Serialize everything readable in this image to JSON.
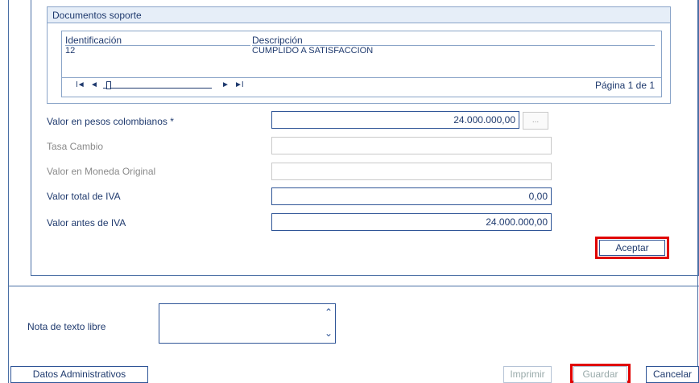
{
  "docs": {
    "title": "Documentos soporte",
    "columns": [
      "Identificación",
      "Descripción"
    ],
    "rows": [
      {
        "identificacion": "12",
        "descripcion": "CUMPLIDO A SATISFACCION"
      }
    ],
    "pager": {
      "first": "I◄",
      "prev": "◄",
      "next": "►",
      "last": "►I",
      "page_info": "Página 1 de 1"
    }
  },
  "form": {
    "valor_pesos": {
      "label": "Valor en pesos colombianos *",
      "value": "24.000.000,00"
    },
    "ellipsis": "...",
    "tasa_cambio": {
      "label": "Tasa Cambio",
      "value": ""
    },
    "valor_moneda": {
      "label": "Valor en Moneda Original",
      "value": ""
    },
    "valor_iva": {
      "label": "Valor total de IVA",
      "value": "0,00"
    },
    "valor_antes_iva": {
      "label": "Valor antes de IVA",
      "value": "24.000.000,00"
    },
    "aceptar": "Aceptar"
  },
  "nota": {
    "label": "Nota de texto libre",
    "value": ""
  },
  "footer": {
    "datos": "Datos Administrativos",
    "imprimir": "Imprimir",
    "guardar": "Guardar",
    "cancelar": "Cancelar"
  },
  "colors": {
    "highlight": "#e00000",
    "border": "#2f5597",
    "text": "#1f3a6e"
  }
}
